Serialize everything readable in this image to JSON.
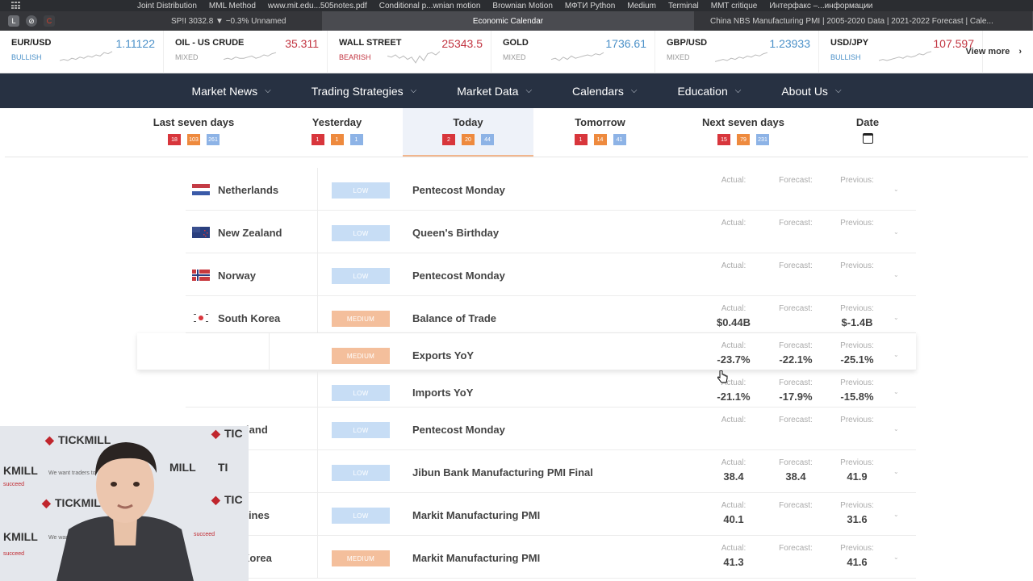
{
  "bookmarks": [
    "Joint Distribution",
    "MML Method",
    "www.mit.edu...505notes.pdf",
    "Conditional p...wnian motion",
    "Brownian Motion",
    "МФТИ Python",
    "Medium",
    "Terminal",
    "MMT critique",
    "Интерфакс –...информации"
  ],
  "tabs": {
    "t1": "SP!I 3032.8 ▼ −0.3% Unnamed",
    "t2": "Economic Calendar",
    "t3": "China NBS Manufacturing PMI | 2005-2020 Data | 2021-2022 Forecast | Cale..."
  },
  "ticker": [
    {
      "name": "EUR/USD",
      "price": "1.11122",
      "sentiment": "BULLISH",
      "color": "#4a90c8",
      "spark": [
        5,
        6,
        5,
        7,
        6,
        8,
        7,
        9,
        8,
        10,
        9,
        12,
        11,
        13
      ]
    },
    {
      "name": "OIL - US CRUDE",
      "price": "35.311",
      "sentiment": "MIXED",
      "color": "#c23440",
      "spark": [
        6,
        7,
        6,
        8,
        7,
        7,
        8,
        9,
        7,
        8,
        10,
        9,
        11,
        12
      ]
    },
    {
      "name": "WALL STREET",
      "price": "25343.5",
      "sentiment": "BEARISH",
      "color": "#c23440",
      "spark": [
        9,
        8,
        10,
        7,
        9,
        6,
        8,
        3,
        9,
        5,
        11,
        12,
        10,
        13
      ]
    },
    {
      "name": "GOLD",
      "price": "1736.61",
      "sentiment": "MIXED",
      "color": "#4a90c8",
      "spark": [
        6,
        7,
        5,
        8,
        6,
        9,
        7,
        8,
        9,
        10,
        9,
        11,
        10,
        12
      ]
    },
    {
      "name": "GBP/USD",
      "price": "1.23933",
      "sentiment": "MIXED",
      "color": "#4a90c8",
      "spark": [
        4,
        5,
        6,
        5,
        7,
        6,
        8,
        7,
        9,
        8,
        10,
        9,
        11,
        12
      ]
    },
    {
      "name": "USD/JPY",
      "price": "107.597",
      "sentiment": "BULLISH",
      "color": "#c23440",
      "spark": [
        5,
        6,
        5,
        6,
        7,
        8,
        7,
        9,
        8,
        9,
        11,
        10,
        12,
        13
      ]
    }
  ],
  "view_more": "View more",
  "nav": [
    "Market News",
    "Trading Strategies",
    "Market Data",
    "Calendars",
    "Education",
    "About Us"
  ],
  "days": [
    {
      "label": "Last seven days",
      "high": "18",
      "medium": "103",
      "low": "261"
    },
    {
      "label": "Yesterday",
      "high": "1",
      "medium": "1",
      "low": "1"
    },
    {
      "label": "Today",
      "high": "2",
      "medium": "20",
      "low": "44"
    },
    {
      "label": "Tomorrow",
      "high": "1",
      "medium": "14",
      "low": "41"
    },
    {
      "label": "Next seven days",
      "high": "15",
      "medium": "79",
      "low": "231"
    },
    {
      "label": "Date"
    }
  ],
  "stat_labels": {
    "actual": "Actual:",
    "forecast": "Forecast:",
    "previous": "Previous:"
  },
  "rows": [
    {
      "country": "Netherlands",
      "flag": "nl",
      "importance": "LOW",
      "event": "Pentecost Monday",
      "actual": "",
      "forecast": "",
      "previous": ""
    },
    {
      "country": "New Zealand",
      "flag": "nz",
      "importance": "LOW",
      "event": "Queen's Birthday",
      "actual": "",
      "forecast": "",
      "previous": ""
    },
    {
      "country": "Norway",
      "flag": "no",
      "importance": "LOW",
      "event": "Pentecost Monday",
      "actual": "",
      "forecast": "",
      "previous": ""
    },
    {
      "country": "South Korea",
      "flag": "kr",
      "importance": "MEDIUM",
      "event": "Balance of Trade",
      "actual": "$0.44B",
      "forecast": "",
      "previous": "$-1.4B"
    },
    {
      "country": "",
      "flag": "",
      "importance": "MEDIUM",
      "event": "Exports YoY",
      "actual": "-23.7%",
      "forecast": "-22.1%",
      "previous": "-25.1%"
    },
    {
      "country": "",
      "flag": "",
      "importance": "LOW",
      "event": "Imports YoY",
      "actual": "-21.1%",
      "forecast": "-17.9%",
      "previous": "-15.8%"
    },
    {
      "country": "rland",
      "flag": "",
      "importance": "LOW",
      "event": "Pentecost Monday",
      "actual": "",
      "forecast": "",
      "previous": ""
    },
    {
      "country": "",
      "flag": "",
      "importance": "LOW",
      "event": "Jibun Bank Manufacturing PMI Final",
      "actual": "38.4",
      "forecast": "38.4",
      "previous": "41.9"
    },
    {
      "country": "pines",
      "flag": "",
      "importance": "LOW",
      "event": "Markit Manufacturing PMI",
      "actual": "40.1",
      "forecast": "",
      "previous": "31.6"
    },
    {
      "country": "Korea",
      "flag": "",
      "importance": "MEDIUM",
      "event": "Markit Manufacturing PMI",
      "actual": "41.3",
      "forecast": "",
      "previous": "41.6"
    }
  ],
  "webcam": {
    "brand": "TICKMILL",
    "tagline": "We want traders to succeed"
  }
}
